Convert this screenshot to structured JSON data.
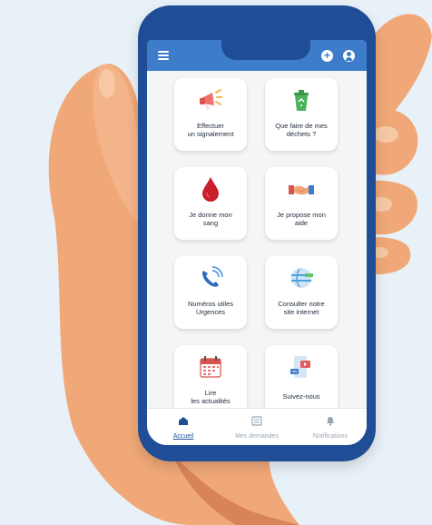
{
  "colors": {
    "background": "#e9f1f8",
    "phone_frame": "#1f4e96",
    "app_bar": "#3d7cc9",
    "skin": "#f0a878",
    "skin_shadow": "#d98458",
    "active_nav": "#1f4e96"
  },
  "app_bar": {
    "icons": [
      "menu-icon",
      "add-icon",
      "user-icon"
    ]
  },
  "tiles": [
    {
      "line1": "Effectuer",
      "line2": "un signalement",
      "icon": "megaphone-icon"
    },
    {
      "line1": "Que faire de mes",
      "line2": "déchets ?",
      "icon": "recycle-bin-icon"
    },
    {
      "line1": "Je donne mon",
      "line2": "sang",
      "icon": "blood-drop-icon"
    },
    {
      "line1": "Je propose mon",
      "line2": "aide",
      "icon": "handshake-icon"
    },
    {
      "line1": "Numéros utiles",
      "line2": "Urgences",
      "icon": "phone-icon"
    },
    {
      "line1": "Consulter notre",
      "line2": "site internet",
      "icon": "globe-icon"
    },
    {
      "line1": "Lire",
      "line2": "les actualités",
      "icon": "calendar-icon"
    },
    {
      "line1": "Suivez-nous",
      "line2": "",
      "icon": "social-icon"
    }
  ],
  "bottom_nav": [
    {
      "label": "Accueil",
      "icon": "home-icon",
      "active": true
    },
    {
      "label": "Mes demandes",
      "icon": "list-icon",
      "active": false
    },
    {
      "label": "Notifications",
      "icon": "bell-icon",
      "active": false
    }
  ]
}
